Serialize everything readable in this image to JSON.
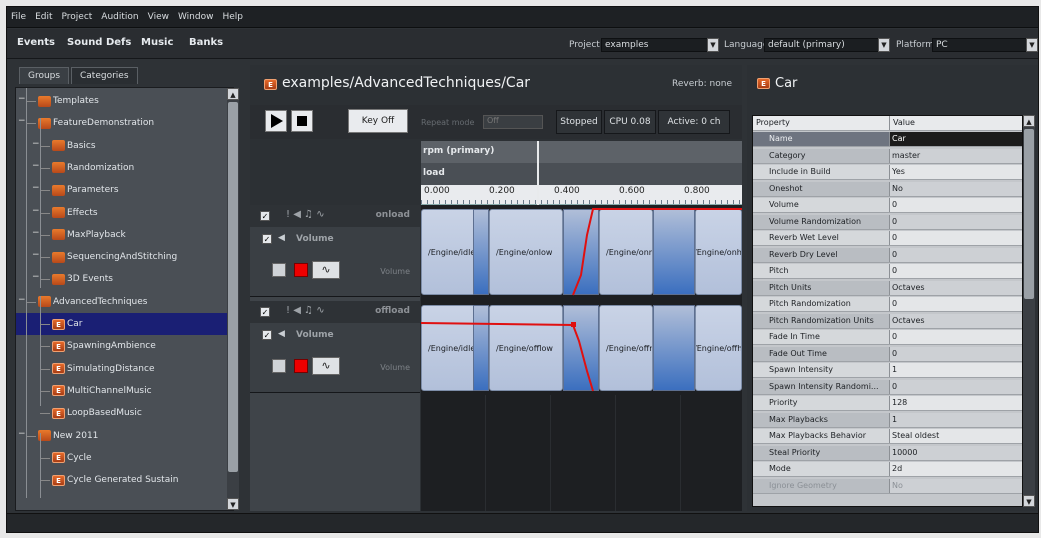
{
  "menu": [
    "File",
    "Edit",
    "Project",
    "Audition",
    "View",
    "Window",
    "Help"
  ],
  "main_tabs": [
    "Events",
    "Sound Defs",
    "Music",
    "Banks"
  ],
  "toolbar": {
    "project_label": "Project",
    "project_value": "examples",
    "language_label": "Language",
    "language_value": "default (primary)",
    "platform_label": "Platform",
    "platform_value": "PC"
  },
  "left": {
    "tabs": [
      "Groups",
      "Categories"
    ],
    "tree": [
      {
        "label": "Templates",
        "type": "folder"
      },
      {
        "label": "FeatureDemonstration",
        "type": "folder"
      },
      {
        "label": "Basics",
        "type": "folder"
      },
      {
        "label": "Randomization",
        "type": "folder"
      },
      {
        "label": "Parameters",
        "type": "folder"
      },
      {
        "label": "Effects",
        "type": "folder"
      },
      {
        "label": "MaxPlayback",
        "type": "folder"
      },
      {
        "label": "SequencingAndStitching",
        "type": "folder"
      },
      {
        "label": "3D Events",
        "type": "folder"
      },
      {
        "label": "AdvancedTechniques",
        "type": "folder"
      },
      {
        "label": "Car",
        "type": "event"
      },
      {
        "label": "SpawningAmbience",
        "type": "event"
      },
      {
        "label": "SimulatingDistance",
        "type": "event"
      },
      {
        "label": "MultiChannelMusic",
        "type": "event"
      },
      {
        "label": "LoopBasedMusic",
        "type": "event"
      },
      {
        "label": "New 2011",
        "type": "folder"
      },
      {
        "label": "Cycle",
        "type": "event"
      },
      {
        "label": "Cycle Generated Sustain",
        "type": "event"
      }
    ]
  },
  "center": {
    "title": "examples/AdvancedTechniques/Car",
    "reverb": "Reverb: none",
    "key_off": "Key Off",
    "repeat_mode_label": "Repeat mode",
    "repeat_mode_value": "Off",
    "status": "Stopped",
    "cpu": "CPU 0.08",
    "active": "Active: 0 ch",
    "param_primary": "rpm (primary)",
    "param_load": "load",
    "ruler": [
      "0.000",
      "0.200",
      "0.400",
      "0.600",
      "0.800"
    ],
    "layers": [
      {
        "name": "onload",
        "effect": "Volume",
        "vol_label": "Volume",
        "sounds": [
          "/Engine/idle",
          "/Engine/onlow",
          "/Engine/onmid",
          "/Engine/onhigh"
        ]
      },
      {
        "name": "offload",
        "effect": "Volume",
        "vol_label": "Volume",
        "sounds": [
          "/Engine/idle",
          "/Engine/offlow",
          "/Engine/offmid",
          "/Engine/offhigh"
        ]
      }
    ]
  },
  "right": {
    "title": "Car",
    "col_property": "Property",
    "col_value": "Value",
    "props": [
      {
        "name": "Name",
        "value": "Car"
      },
      {
        "name": "Category",
        "value": "master"
      },
      {
        "name": "Include in Build",
        "value": "Yes"
      },
      {
        "name": "Oneshot",
        "value": "No"
      },
      {
        "name": "Volume",
        "value": "0"
      },
      {
        "name": "Volume Randomization",
        "value": "0"
      },
      {
        "name": "Reverb Wet Level",
        "value": "0"
      },
      {
        "name": "Reverb Dry Level",
        "value": "0"
      },
      {
        "name": "Pitch",
        "value": "0"
      },
      {
        "name": "Pitch Units",
        "value": "Octaves"
      },
      {
        "name": "Pitch Randomization",
        "value": "0"
      },
      {
        "name": "Pitch Randomization Units",
        "value": "Octaves"
      },
      {
        "name": "Fade In Time",
        "value": "0"
      },
      {
        "name": "Fade Out Time",
        "value": "0"
      },
      {
        "name": "Spawn Intensity",
        "value": "1"
      },
      {
        "name": "Spawn Intensity Randomi...",
        "value": "0"
      },
      {
        "name": "Priority",
        "value": "128"
      },
      {
        "name": "Max Playbacks",
        "value": "1"
      },
      {
        "name": "Max Playbacks Behavior",
        "value": "Steal oldest"
      },
      {
        "name": "Steal Priority",
        "value": "10000"
      },
      {
        "name": "Mode",
        "value": "2d"
      },
      {
        "name": "Ignore Geometry",
        "value": "No"
      }
    ]
  },
  "colors": {
    "accent_selection": "#1a1f74",
    "envelope": "#e01010",
    "event_icon": "#e56a2a"
  }
}
